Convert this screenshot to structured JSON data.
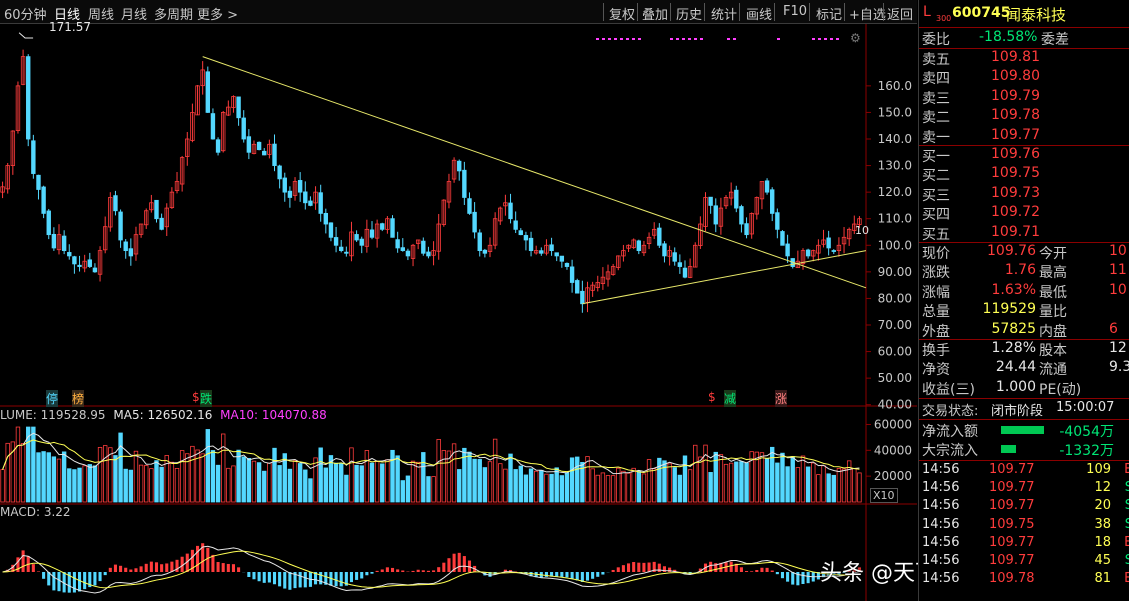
{
  "toolbar": {
    "periods": [
      "60分钟",
      "日线",
      "周线",
      "月线",
      "多周期",
      "更多 >"
    ],
    "active_period": "日线",
    "tools": [
      "复权",
      "叠加",
      "历史",
      "统计",
      "画线",
      "F10",
      "标记",
      "+自选",
      "返回"
    ]
  },
  "stock": {
    "flag": "L",
    "sub": "300",
    "code": "600745",
    "name": "闻泰科技"
  },
  "weibi": {
    "label": "委比",
    "value": "-18.58%",
    "label2": "委差"
  },
  "asks": [
    {
      "label": "卖五",
      "price": "109.81"
    },
    {
      "label": "卖四",
      "price": "109.80"
    },
    {
      "label": "卖三",
      "price": "109.79"
    },
    {
      "label": "卖二",
      "price": "109.78"
    },
    {
      "label": "卖一",
      "price": "109.77"
    }
  ],
  "bids": [
    {
      "label": "买一",
      "price": "109.76"
    },
    {
      "label": "买二",
      "price": "109.75"
    },
    {
      "label": "买三",
      "price": "109.73"
    },
    {
      "label": "买四",
      "price": "109.72"
    },
    {
      "label": "买五",
      "price": "109.71"
    }
  ],
  "quote": [
    {
      "l": "现价",
      "v": "109.76",
      "l2": "今开",
      "v2": "10"
    },
    {
      "l": "涨跌",
      "v": "1.76",
      "l2": "最高",
      "v2": "11"
    },
    {
      "l": "涨幅",
      "v": "1.63%",
      "l2": "最低",
      "v2": "10"
    },
    {
      "l": "总量",
      "v": "119529",
      "l2": "量比",
      "v2": ""
    },
    {
      "l": "外盘",
      "v": "57825",
      "l2": "内盘",
      "v2": "6"
    }
  ],
  "stats": [
    {
      "l": "换手",
      "v": "1.28%",
      "l2": "股本",
      "v2": "12"
    },
    {
      "l": "净资",
      "v": "24.44",
      "l2": "流通",
      "v2": "9.3"
    },
    {
      "l": "收益(三)",
      "v": "1.000",
      "l2": "PE(动)",
      "v2": ""
    }
  ],
  "trade_state": {
    "label": "交易状态:",
    "value": "闭市阶段",
    "time": "15:00:07"
  },
  "flows": [
    {
      "l": "净流入额",
      "v": "-4054万",
      "ratio": 0.62
    },
    {
      "l": "大宗流入",
      "v": "-1332万",
      "ratio": 0.22
    }
  ],
  "ticks": [
    {
      "t": "14:56",
      "p": "109.77",
      "q": "109",
      "s": "B"
    },
    {
      "t": "14:56",
      "p": "109.77",
      "q": "12",
      "s": "S"
    },
    {
      "t": "14:56",
      "p": "109.77",
      "q": "20",
      "s": "S"
    },
    {
      "t": "14:56",
      "p": "109.75",
      "q": "38",
      "s": "S"
    },
    {
      "t": "14:56",
      "p": "109.77",
      "q": "18",
      "s": "B"
    },
    {
      "t": "14:56",
      "p": "109.77",
      "q": "45",
      "s": "S"
    },
    {
      "t": "14:56",
      "p": "109.78",
      "q": "81",
      "s": "B"
    }
  ],
  "vol_info": {
    "lume": "LUME: 119528.95",
    "ma5": "MA5: 126502.16",
    "ma10": "MA10: 104070.88"
  },
  "macd_info": "MACD: 3.22",
  "markers": {
    "high": "171.57",
    "x10": "X10",
    "price_tag": "10"
  },
  "events": [
    "停",
    "榜",
    "跌",
    "$",
    "减",
    "涨"
  ],
  "watermark": "头条 @天下至柔莫若水",
  "colors": {
    "up": "#ff3c3c",
    "down": "#54d8ff",
    "trend": "#e8e86a",
    "ma5": "#e6e6e6",
    "ma10": "#ffff54",
    "pink": "#ff40ff"
  },
  "chart_data": [
    {
      "type": "candlestick",
      "ylim": [
        35,
        175
      ],
      "y_ticks": [
        "160.0",
        "150.0",
        "140.0",
        "130.0",
        "120.0",
        "110.0",
        "100.0",
        "90.00",
        "80.00",
        "70.00",
        "60.00",
        "50.00",
        "40.00"
      ],
      "close": [
        122,
        130,
        143,
        160,
        171,
        140,
        127,
        121,
        112,
        104,
        99,
        104,
        98,
        96,
        93,
        92,
        94,
        92,
        90,
        98,
        107,
        118,
        113,
        102,
        98,
        96,
        104,
        108,
        113,
        116,
        110,
        106,
        114,
        120,
        124,
        133,
        140,
        150,
        160,
        166,
        150,
        140,
        135,
        150,
        152,
        156,
        148,
        140,
        135,
        138,
        136,
        134,
        138,
        130,
        125,
        120,
        118,
        124,
        120,
        116,
        115,
        120,
        112,
        108,
        103,
        100,
        98,
        97,
        105,
        102,
        100,
        106,
        103,
        108,
        106,
        110,
        103,
        99,
        98,
        96,
        100,
        102,
        97,
        96,
        98,
        108,
        117,
        124,
        132,
        128,
        118,
        112,
        105,
        98,
        97,
        100,
        110,
        114,
        116,
        110,
        106,
        104,
        102,
        98,
        98,
        97,
        100,
        98,
        96,
        94,
        92,
        86,
        82,
        78,
        84,
        85,
        86,
        88,
        90,
        92,
        96,
        98,
        100,
        102,
        98,
        100,
        103,
        106,
        100,
        96,
        98,
        94,
        92,
        88,
        92,
        100,
        108,
        118,
        115,
        108,
        114,
        118,
        120,
        114,
        108,
        104,
        112,
        118,
        124,
        120,
        112,
        106,
        100,
        96,
        92,
        94,
        98,
        96,
        98,
        100,
        102,
        99,
        98,
        100,
        103,
        106,
        108,
        110
      ]
    },
    {
      "type": "bar",
      "title": "VOLUME",
      "y_ticks": [
        "60000",
        "40000",
        "20000"
      ],
      "ylim": [
        0,
        65000
      ]
    },
    {
      "type": "bar",
      "title": "MACD"
    }
  ]
}
